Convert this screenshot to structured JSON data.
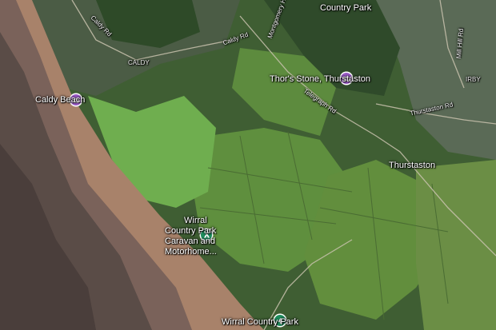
{
  "map": {
    "places": {
      "country_park_top": "Country Park",
      "caldy_beach": "Caldy Beach",
      "thors_stone": "Thor's Stone, Thurstaston",
      "thurstaston": "Thurstaston",
      "wirral_caravan": [
        "Wirral",
        "Country Park",
        "Caravan and",
        "Motorhome..."
      ],
      "wirral_country_park": "Wirral Country Park",
      "caldy_small": "CALDY",
      "irby_small": "IRBY"
    },
    "roads": {
      "caldy_rd_1": "Caldy Rd",
      "caldy_rd_2": "Caldy Rd",
      "montgomery": "Montgomery Hill",
      "telegraph_rd": "Telegraph Rd",
      "thurstaston_rd": "Thurstaston Rd",
      "mill_hill_rd": "Mill Hill Rd"
    },
    "colors": {
      "sand": "#a8826a",
      "water": "#5a4c47",
      "fields": "#5f8f3e",
      "woods": "#2f4a2a",
      "poi_purple": "#9b5cc7",
      "poi_green": "#1e8e5e"
    },
    "icons": [
      "camera-icon",
      "camera-icon",
      "tent-icon",
      "tree-icon"
    ]
  }
}
